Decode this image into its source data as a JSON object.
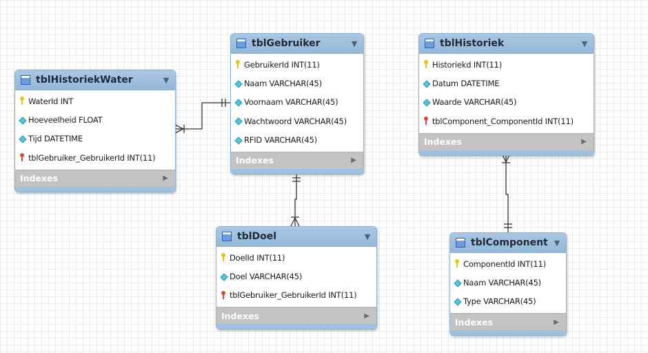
{
  "tables": {
    "historiek_water": {
      "name": "tblHistoriekWater",
      "columns": [
        {
          "name": "WaterId INT",
          "kind": "pk"
        },
        {
          "name": "Hoeveelheid FLOAT",
          "kind": "attr"
        },
        {
          "name": "Tijd DATETIME",
          "kind": "attr"
        },
        {
          "name": "tblGebruiker_GebruikerId INT(11)",
          "kind": "fk"
        }
      ],
      "indexes_label": "Indexes"
    },
    "gebruiker": {
      "name": "tblGebruiker",
      "columns": [
        {
          "name": "GebruikerId INT(11)",
          "kind": "pk"
        },
        {
          "name": "Naam VARCHAR(45)",
          "kind": "attr"
        },
        {
          "name": "Voornaam VARCHAR(45)",
          "kind": "attr"
        },
        {
          "name": "Wachtwoord VARCHAR(45)",
          "kind": "attr"
        },
        {
          "name": "RFID VARCHAR(45)",
          "kind": "attr"
        }
      ],
      "indexes_label": "Indexes"
    },
    "historiek": {
      "name": "tblHistoriek",
      "columns": [
        {
          "name": "Historiekd INT(11)",
          "kind": "pk"
        },
        {
          "name": "Datum DATETIME",
          "kind": "attr"
        },
        {
          "name": "Waarde VARCHAR(45)",
          "kind": "attr"
        },
        {
          "name": "tblComponent_ComponentId INT(11)",
          "kind": "fk"
        }
      ],
      "indexes_label": "Indexes"
    },
    "doel": {
      "name": "tblDoel",
      "columns": [
        {
          "name": "DoelId INT(11)",
          "kind": "pk"
        },
        {
          "name": "Doel VARCHAR(45)",
          "kind": "attr"
        },
        {
          "name": "tblGebruiker_GebruikerId INT(11)",
          "kind": "fk"
        }
      ],
      "indexes_label": "Indexes"
    },
    "component": {
      "name": "tblComponent",
      "columns": [
        {
          "name": "ComponentId INT(11)",
          "kind": "pk"
        },
        {
          "name": "Naam VARCHAR(45)",
          "kind": "attr"
        },
        {
          "name": "Type VARCHAR(45)",
          "kind": "attr"
        }
      ],
      "indexes_label": "Indexes"
    }
  },
  "relationships": [
    {
      "from": "tblGebruiker",
      "to": "tblHistoriekWater",
      "cardinality": "one-to-many"
    },
    {
      "from": "tblGebruiker",
      "to": "tblDoel",
      "cardinality": "one-to-many"
    },
    {
      "from": "tblComponent",
      "to": "tblHistoriek",
      "cardinality": "one-to-many"
    }
  ],
  "colors": {
    "header": "#9ebfdf",
    "header_border": "#8eb1cf",
    "indexes_bg": "#c3c3c3",
    "primary_key": "#e8c21c",
    "foreign_key": "#d9473b",
    "attribute": "#58c3d8",
    "connector": "#333333"
  }
}
